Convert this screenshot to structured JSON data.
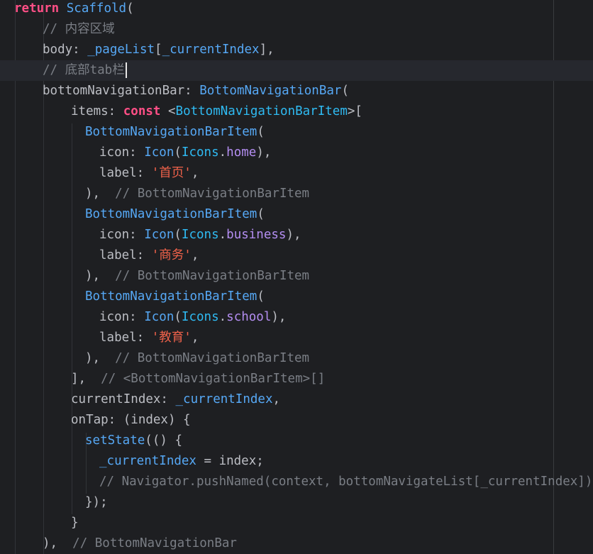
{
  "theme": {
    "background": "#1e1f22",
    "current_line": "#26282e",
    "keyword": "#cf8e6d",
    "keyword_const": "#ff4f86",
    "type": "#56a8f5",
    "field": "#b48ef2",
    "string": "#f0624a",
    "comment": "#7a7e85",
    "plain": "#bcbec4"
  },
  "editor": {
    "language": "dart",
    "cursor_line": 4,
    "lines": [
      {
        "tokens": [
          {
            "t": "return",
            "c": "kw2"
          },
          {
            "t": " "
          },
          {
            "t": "Scaffold",
            "c": "cls"
          },
          {
            "t": "("
          }
        ]
      },
      {
        "tokens": [
          {
            "t": "// 内容区域",
            "c": "cm"
          }
        ]
      },
      {
        "tokens": [
          {
            "t": "body: "
          },
          {
            "t": "_pageList",
            "c": "cls"
          },
          {
            "t": "["
          },
          {
            "t": "_currentIndex",
            "c": "cls"
          },
          {
            "t": "],"
          }
        ]
      },
      {
        "tokens": [
          {
            "t": "// 底部tab栏",
            "c": "cm"
          }
        ]
      },
      {
        "tokens": [
          {
            "t": "bottomNavigationBar: "
          },
          {
            "t": "BottomNavigationBar",
            "c": "cls"
          },
          {
            "t": "("
          }
        ]
      },
      {
        "tokens": [
          {
            "t": "items: "
          },
          {
            "t": "const",
            "c": "kw2"
          },
          {
            "t": " <"
          },
          {
            "t": "BottomNavigationBarItem",
            "c": "clsb"
          },
          {
            "t": ">["
          }
        ]
      },
      {
        "tokens": [
          {
            "t": "BottomNavigationBarItem",
            "c": "cls"
          },
          {
            "t": "("
          }
        ]
      },
      {
        "tokens": [
          {
            "t": "icon: "
          },
          {
            "t": "Icon",
            "c": "cls"
          },
          {
            "t": "("
          },
          {
            "t": "Icons",
            "c": "clsb"
          },
          {
            "t": "."
          },
          {
            "t": "home",
            "c": "fld"
          },
          {
            "t": "),"
          }
        ]
      },
      {
        "tokens": [
          {
            "t": "label: "
          },
          {
            "t": "'首页'",
            "c": "str"
          },
          {
            "t": ","
          }
        ]
      },
      {
        "tokens": [
          {
            "t": "),  "
          },
          {
            "t": "// BottomNavigationBarItem",
            "c": "cm"
          }
        ]
      },
      {
        "tokens": [
          {
            "t": "BottomNavigationBarItem",
            "c": "cls"
          },
          {
            "t": "("
          }
        ]
      },
      {
        "tokens": [
          {
            "t": "icon: "
          },
          {
            "t": "Icon",
            "c": "cls"
          },
          {
            "t": "("
          },
          {
            "t": "Icons",
            "c": "clsb"
          },
          {
            "t": "."
          },
          {
            "t": "business",
            "c": "fld"
          },
          {
            "t": "),"
          }
        ]
      },
      {
        "tokens": [
          {
            "t": "label: "
          },
          {
            "t": "'商务'",
            "c": "str"
          },
          {
            "t": ","
          }
        ]
      },
      {
        "tokens": [
          {
            "t": "),  "
          },
          {
            "t": "// BottomNavigationBarItem",
            "c": "cm"
          }
        ]
      },
      {
        "tokens": [
          {
            "t": "BottomNavigationBarItem",
            "c": "cls"
          },
          {
            "t": "("
          }
        ]
      },
      {
        "tokens": [
          {
            "t": "icon: "
          },
          {
            "t": "Icon",
            "c": "cls"
          },
          {
            "t": "("
          },
          {
            "t": "Icons",
            "c": "clsb"
          },
          {
            "t": "."
          },
          {
            "t": "school",
            "c": "fld"
          },
          {
            "t": "),"
          }
        ]
      },
      {
        "tokens": [
          {
            "t": "label: "
          },
          {
            "t": "'教育'",
            "c": "str"
          },
          {
            "t": ","
          }
        ]
      },
      {
        "tokens": [
          {
            "t": "),  "
          },
          {
            "t": "// BottomNavigationBarItem",
            "c": "cm"
          }
        ]
      },
      {
        "tokens": [
          {
            "t": "],  "
          },
          {
            "t": "// <BottomNavigationBarItem>[]",
            "c": "cm"
          }
        ]
      },
      {
        "tokens": [
          {
            "t": "currentIndex: "
          },
          {
            "t": "_currentIndex",
            "c": "cls"
          },
          {
            "t": ","
          }
        ]
      },
      {
        "tokens": [
          {
            "t": "onTap: (index) {"
          }
        ]
      },
      {
        "tokens": [
          {
            "t": "setState",
            "c": "fn"
          },
          {
            "t": "(() {"
          }
        ]
      },
      {
        "tokens": [
          {
            "t": "_currentIndex",
            "c": "cls"
          },
          {
            "t": " = index;"
          }
        ]
      },
      {
        "tokens": [
          {
            "t": "// Navigator.pushNamed(context, bottomNavigateList[_currentIndex]);",
            "c": "cm"
          }
        ]
      },
      {
        "tokens": [
          {
            "t": "});"
          }
        ]
      },
      {
        "tokens": [
          {
            "t": "}"
          }
        ]
      },
      {
        "tokens": [
          {
            "t": "),  "
          },
          {
            "t": "// BottomNavigationBar",
            "c": "cm"
          }
        ]
      }
    ]
  }
}
